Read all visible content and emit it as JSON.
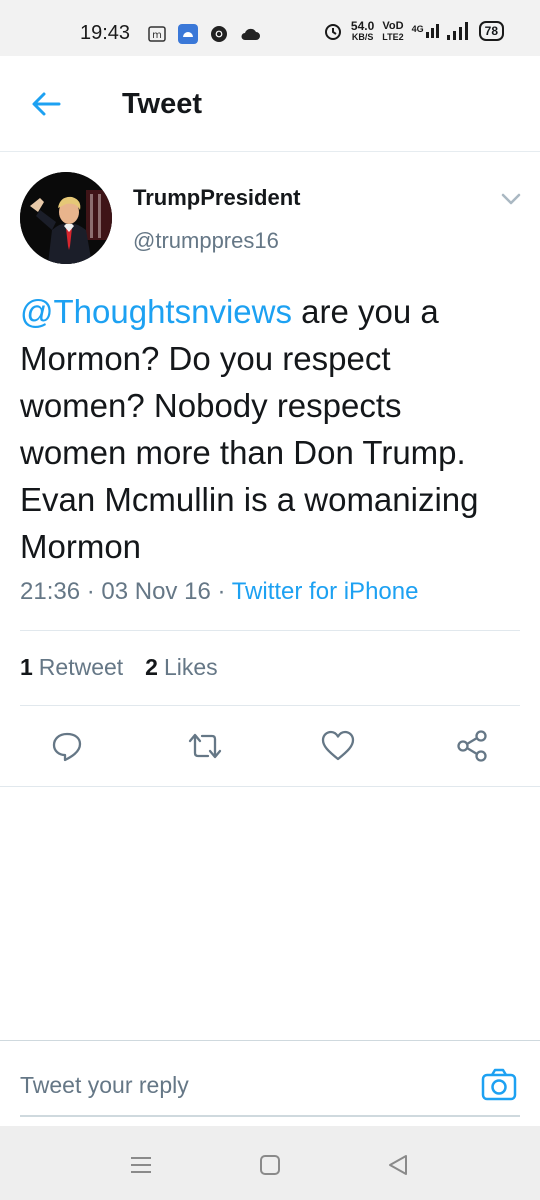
{
  "status_bar": {
    "time": "19:43",
    "net_speed_value": "54.0",
    "net_speed_unit": "KB/S",
    "volte_top": "VoD",
    "volte_bottom": "LTE2",
    "signal_label": "4G",
    "battery": "78"
  },
  "header": {
    "title": "Tweet"
  },
  "tweet": {
    "author_name": "TrumpPresident",
    "author_handle": "@trumppres16",
    "mention": "@Thoughtsnviews",
    "text_body": " are you a Mormon? Do you respect women? Nobody respects women more than Don Trump. Evan Mcmullin is a womanizing Mormon",
    "time": "21:36",
    "separator": " · ",
    "date": "03 Nov 16",
    "source": "Twitter for iPhone",
    "retweet_count": "1",
    "retweet_label": "Retweet",
    "like_count": "2",
    "like_label": "Likes"
  },
  "reply": {
    "placeholder": "Tweet your reply"
  },
  "colors": {
    "accent": "#1da1f2",
    "text": "#14171a",
    "muted": "#657786"
  },
  "icons": {
    "back": "arrow-left-icon",
    "caret": "chevron-down-icon",
    "reply": "comment-icon",
    "retweet": "retweet-icon",
    "like": "heart-icon",
    "share": "share-icon",
    "camera": "camera-icon"
  }
}
